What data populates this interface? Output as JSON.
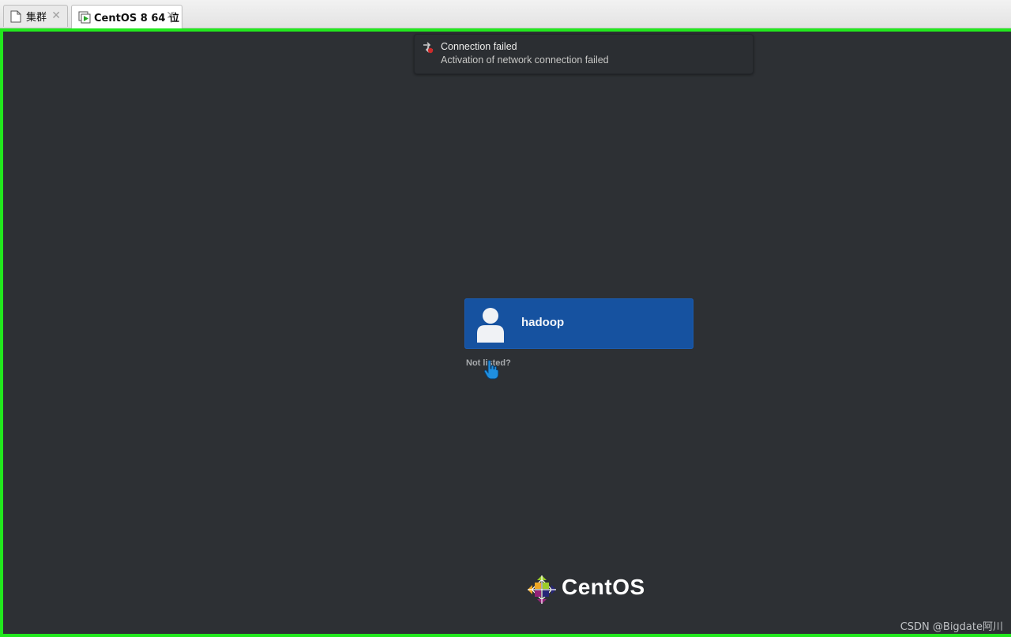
{
  "tabs": [
    {
      "label": "集群",
      "active": false,
      "icon": "page-icon"
    },
    {
      "label": "CentOS 8 64 位",
      "active": true,
      "icon": "vm-running-icon"
    }
  ],
  "tab_close_glyph": "✕",
  "notification": {
    "icon": "network-error-icon",
    "title": "Connection failed",
    "body": "Activation of network connection failed"
  },
  "login": {
    "user": {
      "name": "hadoop",
      "avatar": "user-avatar-icon"
    },
    "not_listed": "Not listed?"
  },
  "branding": {
    "logo_text": "CentOS"
  },
  "watermark": "CSDN @Bigdate阿川",
  "colors": {
    "frame_border": "#22e81e",
    "background": "#2d3034",
    "user_card": "#1652a0"
  }
}
